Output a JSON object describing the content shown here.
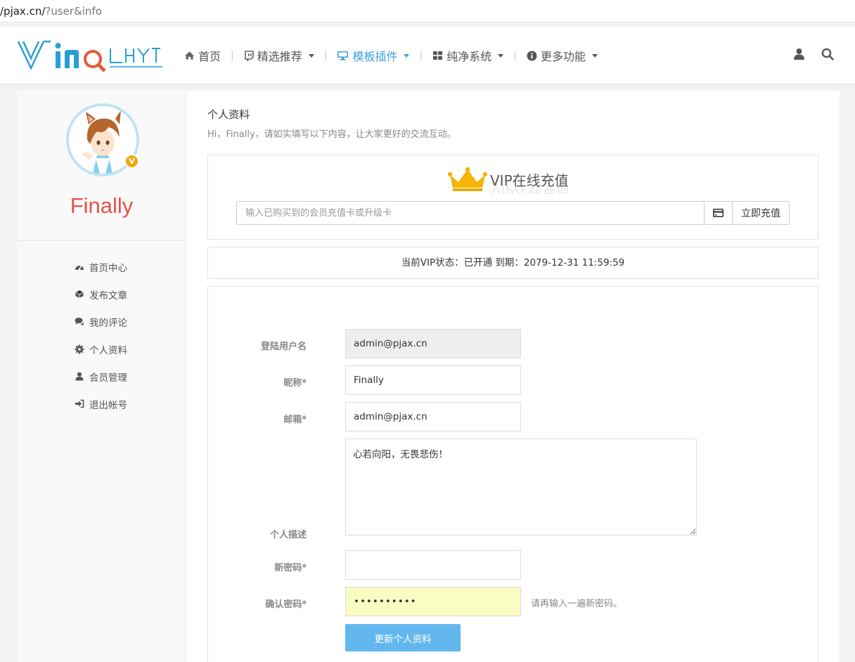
{
  "browser": {
    "url_host": "/pjax.cn/",
    "url_path": "?user&info"
  },
  "nav": {
    "items": [
      {
        "label": "首页",
        "icon": "home-icon"
      },
      {
        "label": "精选推荐",
        "icon": "twitch-icon"
      },
      {
        "label": "模板插件",
        "icon": "desktop-icon",
        "active": true
      },
      {
        "label": "纯净系统",
        "icon": "grid-icon"
      },
      {
        "label": "更多功能",
        "icon": "info-circle-icon"
      }
    ],
    "right_icons": [
      "user-icon",
      "search-icon"
    ]
  },
  "sidebar": {
    "username": "Finally",
    "vip_badge": "V",
    "menu": [
      {
        "label": "首页中心",
        "icon": "dashboard-icon"
      },
      {
        "label": "发布文章",
        "icon": "cube-icon"
      },
      {
        "label": "我的评论",
        "icon": "comments-icon"
      },
      {
        "label": "个人资料",
        "icon": "cog-icon"
      },
      {
        "label": "会员管理",
        "icon": "user-icon"
      },
      {
        "label": "退出帐号",
        "icon": "sign-in-icon"
      }
    ]
  },
  "content": {
    "title": "个人资料",
    "subtitle": "Hi，Finally，请如实填写以下内容，让大家更好的交流互动。"
  },
  "vip": {
    "title": "VIP在线充值",
    "input_placeholder": "输入已购买到的会员充值卡或升级卡",
    "pay_button": "立即充值"
  },
  "status": {
    "text": "当前VIP状态：已开通 到期：2079-12-31 11:59:59"
  },
  "form": {
    "username_label": "登陆用户名",
    "username_value": "admin@pjax.cn",
    "nickname_label": "昵称*",
    "nickname_value": "Finally",
    "email_label": "邮箱*",
    "email_value": "admin@pjax.cn",
    "desc_label": "个人描述",
    "desc_value": "心若向阳，无畏悲伤！",
    "newpass_label": "新密码*",
    "newpass_value": "",
    "confirm_label": "确认密码*",
    "confirm_value": "••••••••••",
    "confirm_hint": "请再输入一遍新密码。",
    "submit_label": "更新个人资料"
  },
  "colors": {
    "accent": "#3a9fde",
    "username": "#e5534b",
    "submit": "#63b7ef",
    "vip_badge": "#f0a70d",
    "crown": "#f5b400"
  }
}
